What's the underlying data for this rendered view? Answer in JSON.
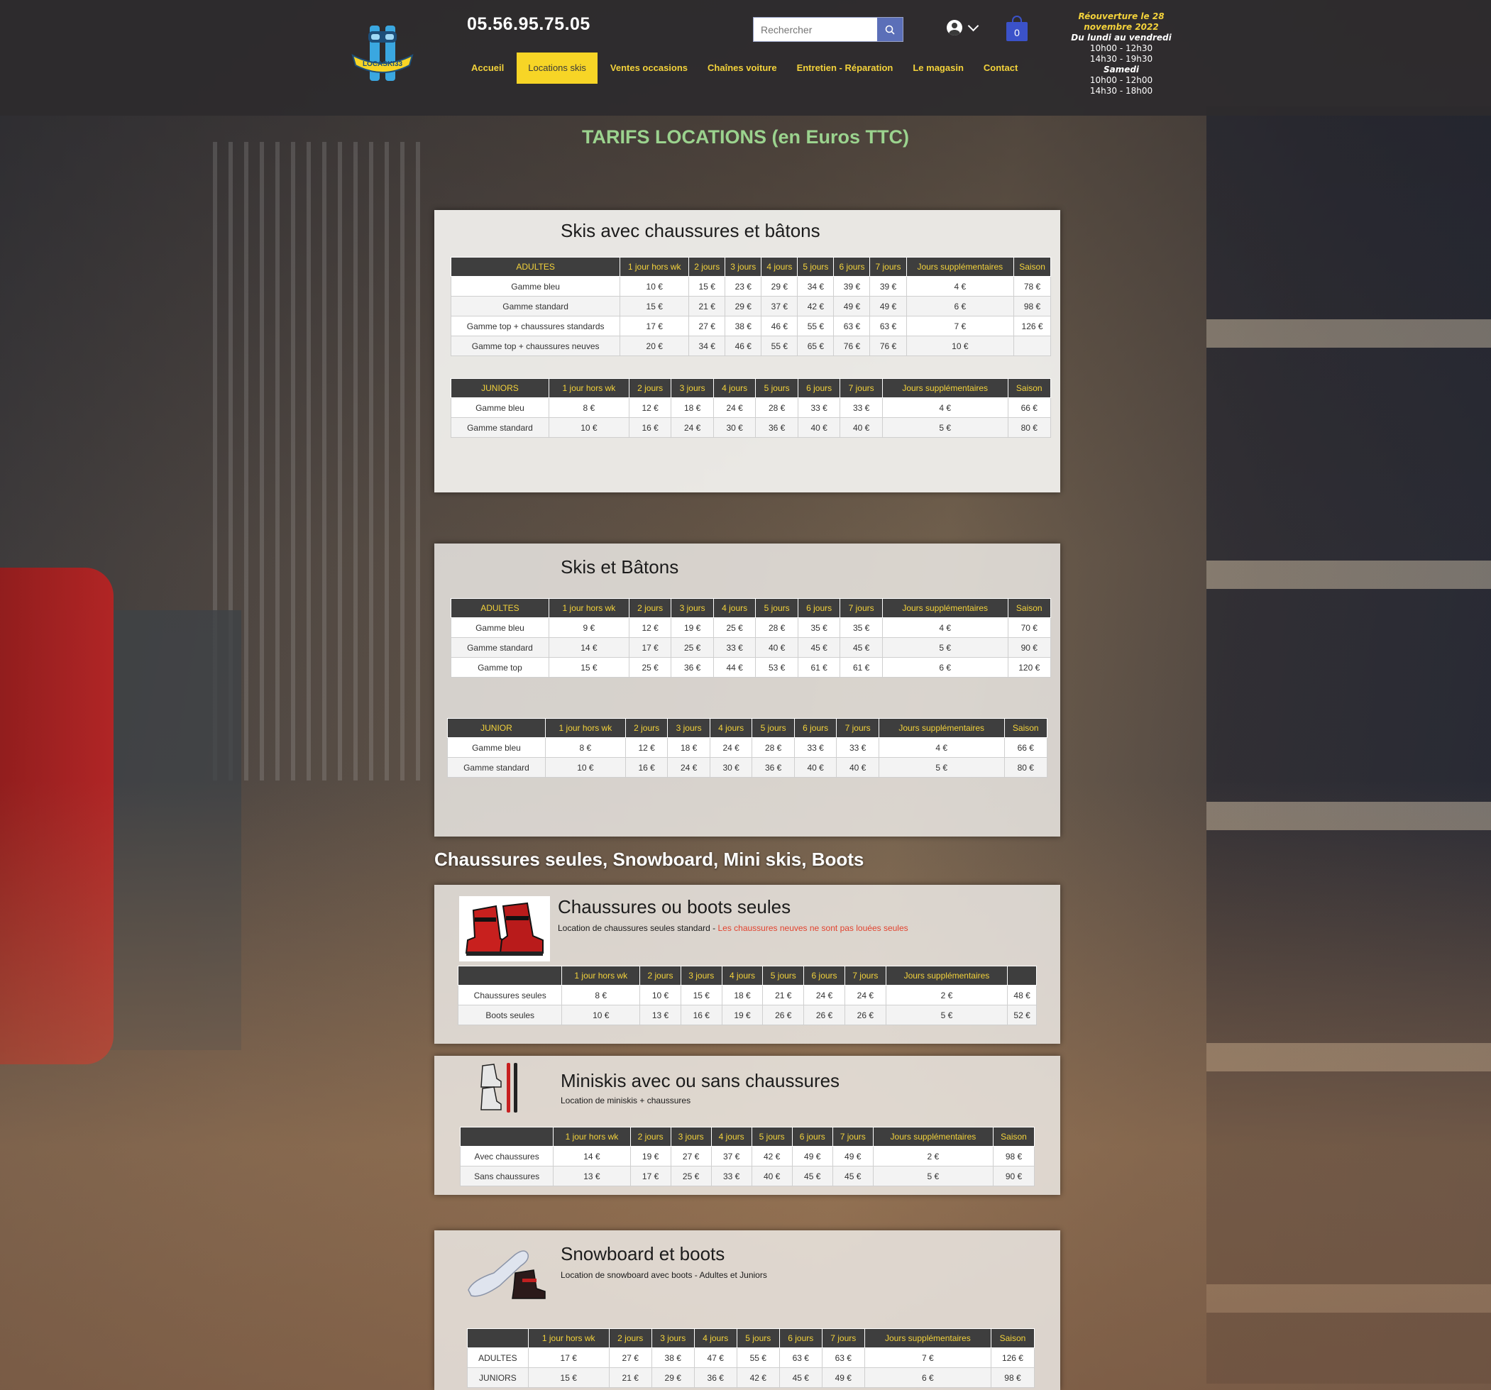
{
  "header": {
    "phone": "05.56.95.75.05",
    "logo_text": "LOCASKI33",
    "nav": [
      "Accueil",
      "Locations skis",
      "Ventes occasions",
      "Chaînes voiture",
      "Entretien - Réparation",
      "Le magasin",
      "Contact"
    ],
    "nav_active": "Locations skis",
    "search_placeholder": "Rechercher",
    "cart_count": "0",
    "hours": {
      "line1": "Réouverture le 28",
      "line2": "novembre 2022",
      "weekday_title": "Du lundi au vendredi",
      "weekday_1": "10h00 - 12h30",
      "weekday_2": "14h30 - 19h30",
      "saturday_title": "Samedi",
      "saturday_1": "10h00 - 12h00",
      "saturday_2": "14h30 - 18h00"
    }
  },
  "page_title": "TARIFS LOCATIONS (en Euros TTC)",
  "panel1": {
    "title": "Skis avec chaussures et bâtons",
    "adultes": {
      "headers": [
        "ADULTES",
        "1 jour hors wk",
        "2 jours",
        "3 jours",
        "4 jours",
        "5 jours",
        "6 jours",
        "7 jours",
        "Jours supplémentaires",
        "Saison"
      ],
      "rows": [
        [
          "Gamme bleu",
          "10 €",
          "15 €",
          "23 €",
          "29 €",
          "34 €",
          "39 €",
          "39 €",
          "4 €",
          "78 €"
        ],
        [
          "Gamme standard",
          "15 €",
          "21 €",
          "29 €",
          "37 €",
          "42 €",
          "49 €",
          "49 €",
          "6 €",
          "98 €"
        ],
        [
          "Gamme top + chaussures standards",
          "17 €",
          "27 €",
          "38 €",
          "46 €",
          "55 €",
          "63 €",
          "63 €",
          "7 €",
          "126 €"
        ],
        [
          "Gamme top + chaussures neuves",
          "20 €",
          "34 €",
          "46 €",
          "55 €",
          "65 €",
          "76 €",
          "76 €",
          "10 €",
          ""
        ]
      ]
    },
    "juniors": {
      "headers": [
        "JUNIORS",
        "1 jour hors wk",
        "2 jours",
        "3 jours",
        "4 jours",
        "5 jours",
        "6 jours",
        "7 jours",
        "Jours supplémentaires",
        "Saison"
      ],
      "rows": [
        [
          "Gamme bleu",
          "8 €",
          "12 €",
          "18 €",
          "24 €",
          "28 €",
          "33 €",
          "33 €",
          "4 €",
          "66 €"
        ],
        [
          "Gamme standard",
          "10 €",
          "16 €",
          "24 €",
          "30 €",
          "36 €",
          "40 €",
          "40 €",
          "5 €",
          "80 €"
        ]
      ]
    }
  },
  "panel2": {
    "title": "Skis et Bâtons",
    "adultes": {
      "headers": [
        "ADULTES",
        "1 jour hors wk",
        "2 jours",
        "3 jours",
        "4 jours",
        "5 jours",
        "6 jours",
        "7 jours",
        "Jours supplémentaires",
        "Saison"
      ],
      "rows": [
        [
          "Gamme bleu",
          "9 €",
          "12 €",
          "19 €",
          "25 €",
          "28 €",
          "35 €",
          "35 €",
          "4 €",
          "70 €"
        ],
        [
          "Gamme standard",
          "14 €",
          "17 €",
          "25 €",
          "33 €",
          "40 €",
          "45 €",
          "45 €",
          "5 €",
          "90 €"
        ],
        [
          "Gamme top",
          "15 €",
          "25 €",
          "36 €",
          "44 €",
          "53 €",
          "61 €",
          "61 €",
          "6 €",
          "120 €"
        ]
      ]
    },
    "junior": {
      "headers": [
        "JUNIOR",
        "1 jour hors wk",
        "2 jours",
        "3 jours",
        "4 jours",
        "5 jours",
        "6 jours",
        "7 jours",
        "Jours supplémentaires",
        "Saison"
      ],
      "rows": [
        [
          "Gamme bleu",
          "8 €",
          "12 €",
          "18 €",
          "24 €",
          "28 €",
          "33 €",
          "33 €",
          "4 €",
          "66 €"
        ],
        [
          "Gamme standard",
          "10 €",
          "16 €",
          "24 €",
          "30 €",
          "36 €",
          "40 €",
          "40 €",
          "5 €",
          "80 €"
        ]
      ]
    }
  },
  "section_heading": "Chaussures seules, Snowboard, Mini skis, Boots",
  "panel3": {
    "title": "Chaussures ou boots seules",
    "subtitle": "Location de chaussures seules standard - ",
    "subtitle_red": "Les chaussures neuves ne sont pas louées seules",
    "headers": [
      "",
      "1 jour hors wk",
      "2 jours",
      "3 jours",
      "4 jours",
      "5 jours",
      "6 jours",
      "7 jours",
      "Jours supplémentaires",
      ""
    ],
    "rows": [
      [
        "Chaussures seules",
        "8 €",
        "10 €",
        "15 €",
        "18 €",
        "21 €",
        "24 €",
        "24 €",
        "2 €",
        "48 €"
      ],
      [
        "Boots seules",
        "10 €",
        "13 €",
        "16 €",
        "19 €",
        "26 €",
        "26 €",
        "26 €",
        "5 €",
        "52 €"
      ]
    ]
  },
  "panel4": {
    "title": "Miniskis avec ou sans chaussures",
    "subtitle": "Location de miniskis + chaussures",
    "headers": [
      "",
      "1 jour hors wk",
      "2 jours",
      "3 jours",
      "4 jours",
      "5 jours",
      "6 jours",
      "7 jours",
      "Jours supplémentaires",
      "Saison"
    ],
    "rows": [
      [
        "Avec chaussures",
        "14 €",
        "19 €",
        "27 €",
        "37 €",
        "42 €",
        "49 €",
        "49 €",
        "2 €",
        "98 €"
      ],
      [
        "Sans chaussures",
        "13 €",
        "17 €",
        "25 €",
        "33 €",
        "40 €",
        "45 €",
        "45 €",
        "5 €",
        "90 €"
      ]
    ]
  },
  "panel5": {
    "title": "Snowboard et boots",
    "subtitle": "Location de snowboard avec boots - Adultes et Juniors",
    "headers": [
      "",
      "1 jour hors wk",
      "2 jours",
      "3 jours",
      "4 jours",
      "5 jours",
      "6 jours",
      "7 jours",
      "Jours supplémentaires",
      "Saison"
    ],
    "rows": [
      [
        "ADULTES",
        "17 €",
        "27 €",
        "38 €",
        "47 €",
        "55 €",
        "63 €",
        "63 €",
        "7 €",
        "126 €"
      ],
      [
        "JUNIORS",
        "15 €",
        "21 €",
        "29 €",
        "36 €",
        "42 €",
        "45 €",
        "49 €",
        "6 €",
        "98 €"
      ]
    ]
  },
  "colors": {
    "accent_yellow": "#f3d23b",
    "title_green": "#9bd38e",
    "cart_blue": "#3b52c9",
    "header_bg": "#2d2b2d",
    "table_header_bg": "#3e3e3e",
    "notice_red": "#e2432f"
  },
  "icons": [
    "search-icon",
    "user-icon",
    "chevron-down-icon",
    "cart-icon"
  ]
}
